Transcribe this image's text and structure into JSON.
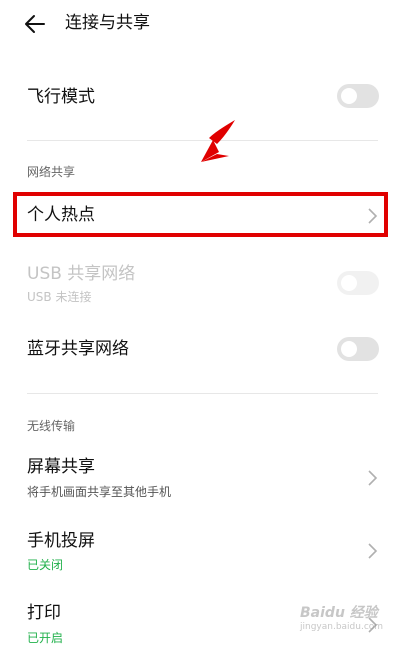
{
  "header": {
    "title": "连接与共享"
  },
  "airplane_mode": {
    "label": "飞行模式",
    "on": false
  },
  "network_sharing": {
    "section_title": "网络共享",
    "hotspot_label": "个人热点",
    "usb_label": "USB 共享网络",
    "usb_sub": "USB 未连接",
    "usb_on": false,
    "bluetooth_label": "蓝牙共享网络",
    "bluetooth_on": false
  },
  "wireless": {
    "section_title": "无线传输",
    "screen_share_label": "屏幕共享",
    "screen_share_sub": "将手机画面共享至其他手机",
    "projection_label": "手机投屏",
    "projection_sub": "已关闭",
    "print_label": "打印",
    "print_sub": "已开启"
  },
  "watermark": {
    "text": "Baidu 经验",
    "url": "jingyan.baidu.com"
  },
  "colors": {
    "highlight": "#e00000",
    "status_green": "#22b14c",
    "toggle_off": "#e2e2e2"
  }
}
